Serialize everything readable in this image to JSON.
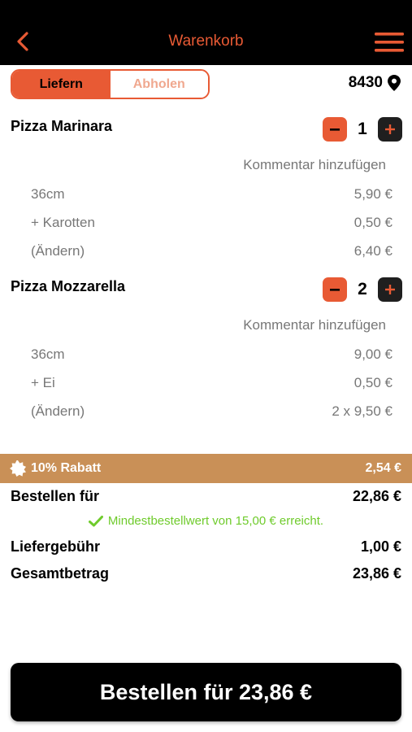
{
  "header": {
    "title": "Warenkorb"
  },
  "mode_toggle": {
    "deliver_label": "Liefern",
    "pickup_label": "Abholen"
  },
  "postal_code": "8430",
  "items": [
    {
      "name": "Pizza Marinara",
      "quantity": "1",
      "comment_label": "Kommentar hinzufügen",
      "options": [
        {
          "label": "36cm",
          "price": "5,90 €"
        },
        {
          "label": "+ Karotten",
          "price": "0,50 €"
        },
        {
          "label": "(Ändern)",
          "price": "6,40 €"
        }
      ]
    },
    {
      "name": "Pizza Mozzarella",
      "quantity": "2",
      "comment_label": "Kommentar hinzufügen",
      "options": [
        {
          "label": "36cm",
          "price": "9,00 €"
        },
        {
          "label": "+ Ei",
          "price": "0,50 €"
        },
        {
          "label": "(Ändern)",
          "price": "2 x 9,50 €"
        }
      ]
    }
  ],
  "discount": {
    "label": "10% Rabatt",
    "amount": "2,54 €"
  },
  "summary": {
    "order_for_label": "Bestellen für",
    "order_for_value": "22,86 €",
    "min_note": "Mindestbestellwert von 15,00 € erreicht.",
    "delivery_fee_label": "Liefergebühr",
    "delivery_fee_value": "1,00 €",
    "total_label": "Gesamtbetrag",
    "total_value": "23,86 €"
  },
  "order_button": {
    "label": "Bestellen für 23,86 €"
  },
  "colors": {
    "accent": "#e85a34",
    "discount_bg": "#c99057",
    "success": "#6fcb2c"
  }
}
